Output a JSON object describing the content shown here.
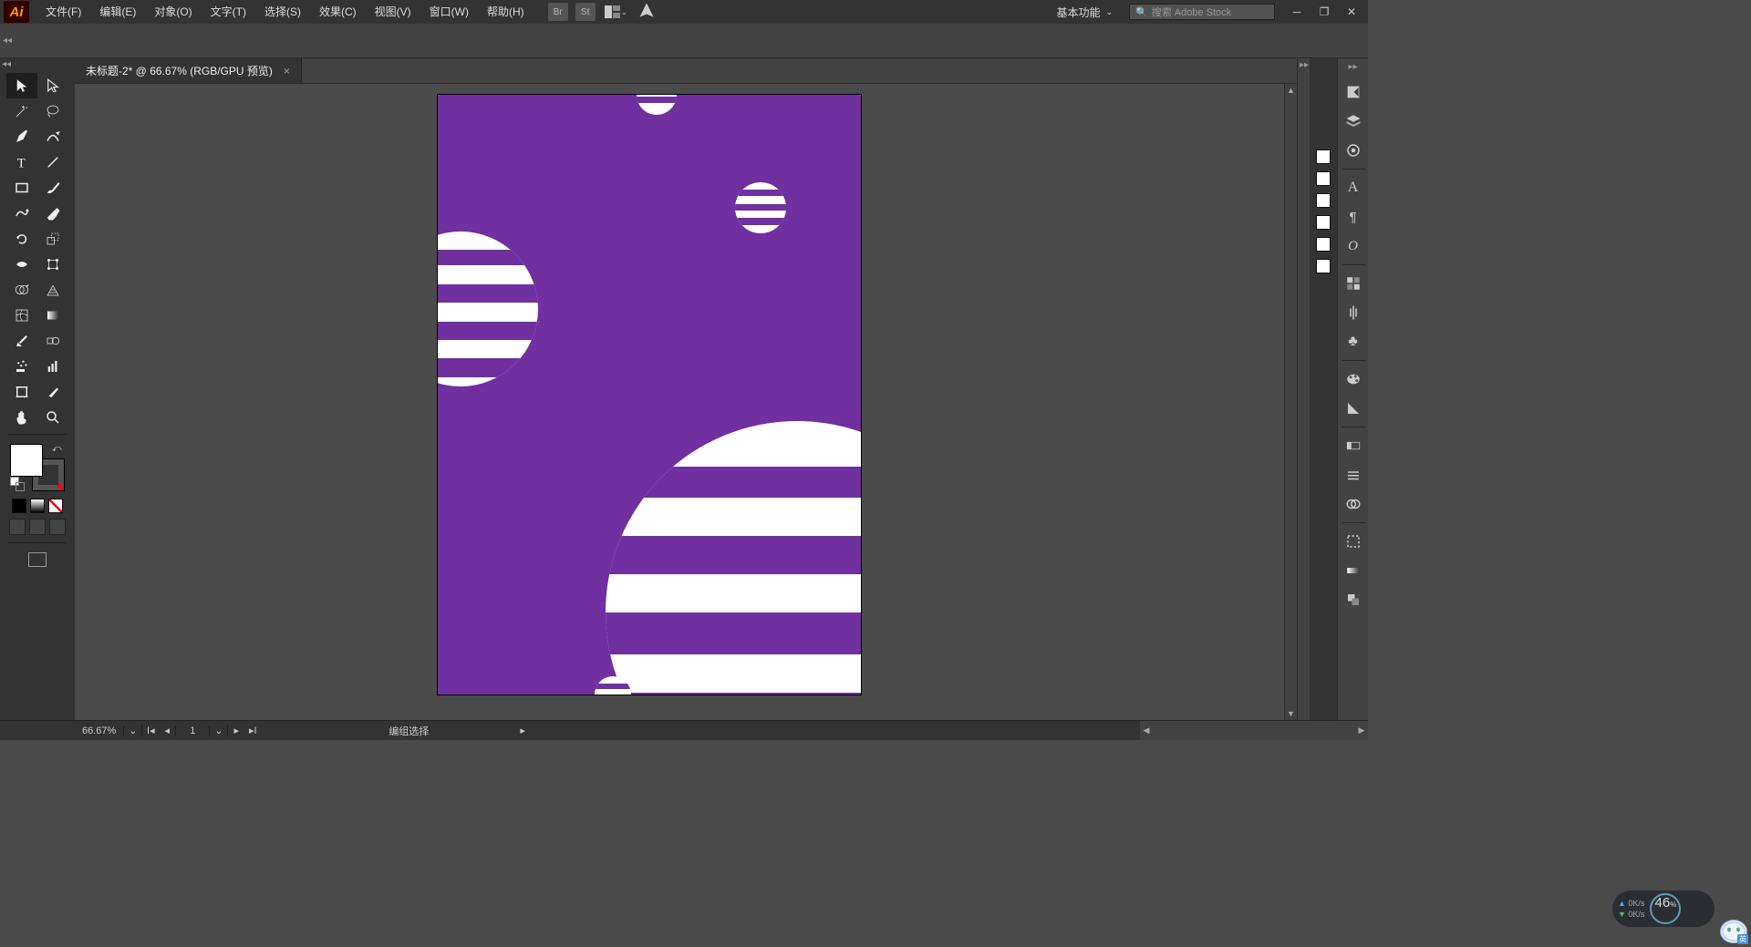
{
  "app": {
    "logo": "Ai"
  },
  "menu": {
    "file": "文件(F)",
    "edit": "编辑(E)",
    "object": "对象(O)",
    "type": "文字(T)",
    "select": "选择(S)",
    "effect": "效果(C)",
    "view": "视图(V)",
    "window": "窗口(W)",
    "help": "帮助(H)"
  },
  "top": {
    "bridge": "Br",
    "stock": "St",
    "workspace": "基本功能",
    "search_placeholder": "搜索 Adobe Stock"
  },
  "controlbar": {
    "label": ""
  },
  "document": {
    "tab_title": "未标题-2* @ 66.67% (RGB/GPU 预览)",
    "artboard_bg": "#7030A0"
  },
  "status": {
    "zoom": "66.67%",
    "artboard_number": "1",
    "selection": "编组选择"
  },
  "netwidget": {
    "up": "0K/s",
    "down": "0K/s",
    "percent": "46",
    "unit": "%"
  },
  "ime": {
    "label": "英"
  },
  "colors": {
    "fill": "#ffffff",
    "black": "#000000",
    "gray": "#888888",
    "registration": "#ffffff"
  }
}
